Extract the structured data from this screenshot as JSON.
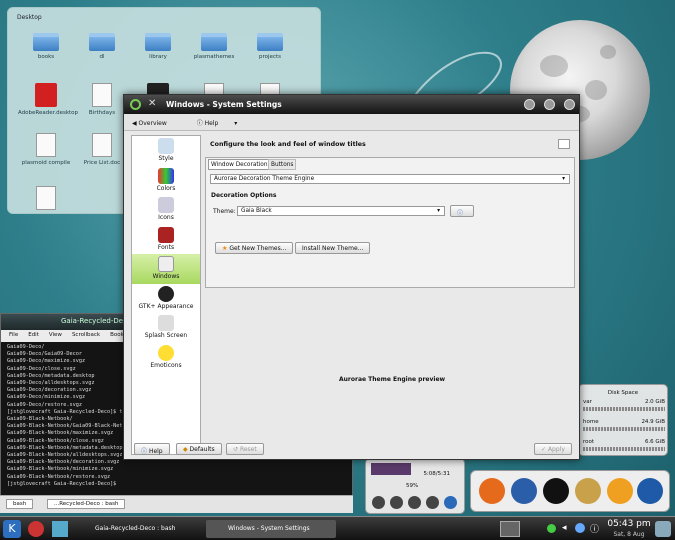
{
  "desktop": {
    "label": "Desktop",
    "icons": [
      {
        "name": "books",
        "kind": "folder"
      },
      {
        "name": "dl",
        "kind": "folder"
      },
      {
        "name": "library",
        "kind": "folder"
      },
      {
        "name": "plasmathemes",
        "kind": "folder"
      },
      {
        "name": "projects",
        "kind": "folder"
      },
      {
        "name": "AdobeReader.desktop",
        "kind": "pdf"
      },
      {
        "name": "Birthdays",
        "kind": "doc"
      },
      {
        "name": "",
        "kind": "black"
      },
      {
        "name": "",
        "kind": "doc"
      },
      {
        "name": "",
        "kind": "doc"
      },
      {
        "name": "plasmoid compile",
        "kind": "doc"
      },
      {
        "name": "Price List.doc",
        "kind": "doc"
      },
      {
        "name": "",
        "kind": "doc"
      }
    ]
  },
  "terminal": {
    "title": "Gaia-Recycled-Deco : bash",
    "menu": [
      "File",
      "Edit",
      "View",
      "Scrollback",
      "Bookmarks"
    ],
    "lines": [
      "Gaia09-Deco/",
      "Gaia09-Deco/Gaia09-Decor",
      "Gaia09-Deco/maximize.svgz",
      "Gaia09-Deco/close.svgz",
      "Gaia09-Deco/metadata.desktop",
      "Gaia09-Deco/alldesktops.svgz",
      "Gaia09-Deco/decoration.svgz",
      "Gaia09-Deco/minimize.svgz",
      "Gaia09-Deco/restore.svgz",
      "[jst@lovecraft Gaia-Recycled-Deco]$ t",
      "Gaia09-Black-Netbook/",
      "Gaia09-Black-Netbook/Gaia09-Black-Net",
      "Gaia09-Black-Netbook/maximize.svgz",
      "Gaia09-Black-Netbook/close.svgz",
      "Gaia09-Black-Netbook/metadata.desktop",
      "Gaia09-Black-Netbook/alldesktops.svgz",
      "Gaia09-Black-Netbook/decoration.svgz",
      "Gaia09-Black-Netbook/minimize.svgz",
      "Gaia09-Black-Netbook/restore.svgz",
      "[jst@lovecraft Gaia-Recycled-Deco]$ "
    ],
    "tab1": "bash",
    "tab2": "...Recycled-Deco : bash"
  },
  "window": {
    "title": "Windows - System Settings",
    "overview": "Overview",
    "help": "Help",
    "sidebar": [
      "Style",
      "Colors",
      "Icons",
      "Fonts",
      "Windows",
      "GTK+ Appearance",
      "Splash Screen",
      "Emoticons"
    ],
    "heading": "Configure the look and feel of window titles",
    "tabs": [
      "Window Decoration",
      "Buttons"
    ],
    "engine": "Aurorae Decoration Theme Engine",
    "options_label": "Decoration Options",
    "theme_label": "Theme:",
    "theme_value": "Gaia Black",
    "get_new": "Get New Themes...",
    "install_new": "Install New Theme...",
    "preview": "Aurorae Theme Engine preview",
    "btn_help": "Help",
    "btn_defaults": "Defaults",
    "btn_reset": "Reset",
    "btn_apply": "Apply"
  },
  "diskspace": {
    "title": "Disk Space",
    "rows": [
      {
        "name": "var",
        "size": "2.0 GiB"
      },
      {
        "name": "home",
        "size": "24.9 GiB"
      },
      {
        "name": "root",
        "size": "6.6 GiB"
      }
    ]
  },
  "media": {
    "time": "5:08/5:31",
    "volume": "59%"
  },
  "panel": {
    "task1": "Gaia-Recycled-Deco : bash",
    "task2": "Windows - System Settings",
    "time": "05:43 pm",
    "date": "Sat, 8 Aug"
  },
  "colors": {
    "selected": "#a8d860",
    "panel": "#1a1a1a"
  }
}
